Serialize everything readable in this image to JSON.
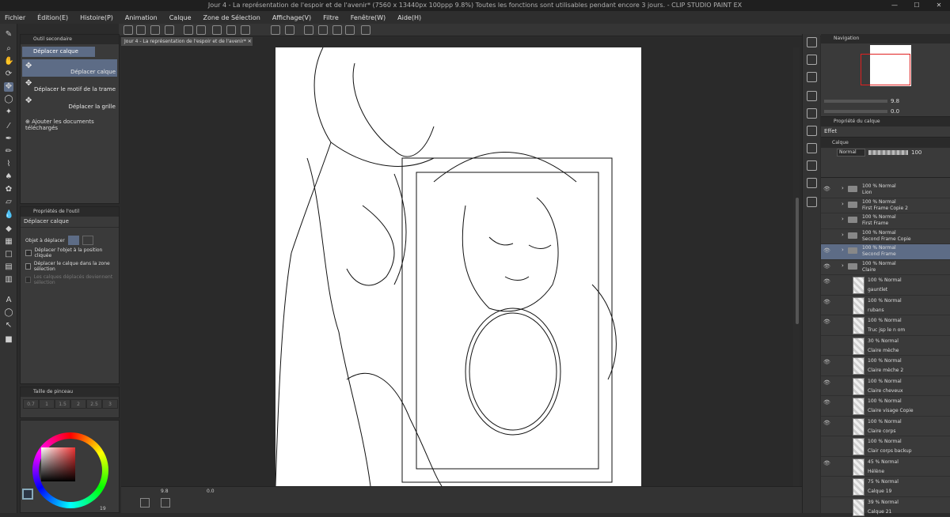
{
  "window": {
    "title": "Jour 4 - La représentation de l'espoir et de l'avenir* (7560 x 13440px 100ppp 9.8%)  Toutes les fonctions sont utilisables pendant encore 3 jours. - CLIP STUDIO PAINT EX"
  },
  "menu": [
    "Fichier",
    "Édition(E)",
    "Histoire(P)",
    "Animation",
    "Calque",
    "Zone de Sélection",
    "Affichage(V)",
    "Filtre",
    "Fenêtre(W)",
    "Aide(H)"
  ],
  "document": {
    "tab": "Jour 4 - La représentation de l'espoir et de l'avenir*"
  },
  "subtool": {
    "header": "Outil secondaire",
    "active_tab": "Déplacer calque",
    "items": [
      {
        "label": "Déplacer calque",
        "selected": true
      },
      {
        "label": "Déplacer le motif de la trame",
        "selected": false
      },
      {
        "label": "Déplacer la grille",
        "selected": false
      }
    ],
    "add_label": "Ajouter les documents téléchargés"
  },
  "toolprops": {
    "header": "Propriétés de l'outil",
    "title": "Déplacer calque",
    "target_label": "Objet à déplacer",
    "options": [
      "Déplacer l'objet à la position cliquée",
      "Déplacer le calque dans la zone sélection",
      "Les calques déplacés deviennent sélection"
    ]
  },
  "brushsize": {
    "header": "Taille de pinceau",
    "sizes": [
      "0.7",
      "1",
      "1.5",
      "2",
      "2.5",
      "3"
    ]
  },
  "color": {
    "counter": "19"
  },
  "canvas": {
    "zoom": "9.8",
    "angle": "0.0"
  },
  "navigator": {
    "header": "Navigation",
    "zoom": "9.8",
    "angle": "0.0"
  },
  "layerprop": {
    "header": "Propriété du calque",
    "effect_label": "Effet"
  },
  "layers": {
    "header": "Calque",
    "blend": "Normal",
    "opacity": "100",
    "rows": [
      {
        "mode": "100 % Normal",
        "name": "Lion",
        "type": "folder",
        "visible": true,
        "selected": false
      },
      {
        "mode": "100 % Normal",
        "name": "First Frame Copie 2",
        "type": "folder",
        "visible": false,
        "selected": false
      },
      {
        "mode": "100 % Normal",
        "name": "First Frame",
        "type": "folder",
        "visible": false,
        "selected": false
      },
      {
        "mode": "100 % Normal",
        "name": "Second Frame Copie",
        "type": "folder",
        "visible": false,
        "selected": false
      },
      {
        "mode": "100 % Normal",
        "name": "Second Frame",
        "type": "folder",
        "visible": true,
        "selected": true
      },
      {
        "mode": "100 % Normal",
        "name": "Claire",
        "type": "folder",
        "visible": true,
        "selected": false
      },
      {
        "mode": "100 % Normal",
        "name": "gauntlet",
        "type": "layer",
        "visible": true,
        "selected": false
      },
      {
        "mode": "100 % Normal",
        "name": "rubans",
        "type": "layer",
        "visible": true,
        "selected": false
      },
      {
        "mode": "100 % Normal",
        "name": "Truc jsp le n om",
        "type": "layer",
        "visible": true,
        "selected": false
      },
      {
        "mode": "30 % Normal",
        "name": "Claire mèche",
        "type": "layer",
        "visible": false,
        "selected": false
      },
      {
        "mode": "100 % Normal",
        "name": "Claire mèche 2",
        "type": "layer",
        "visible": true,
        "selected": false
      },
      {
        "mode": "100 % Normal",
        "name": "Claire cheveux",
        "type": "layer",
        "visible": true,
        "selected": false
      },
      {
        "mode": "100 % Normal",
        "name": "Claire visage Copie",
        "type": "layer",
        "visible": true,
        "selected": false
      },
      {
        "mode": "100 % Normal",
        "name": "Claire corps",
        "type": "layer",
        "visible": true,
        "selected": false
      },
      {
        "mode": "100 % Normal",
        "name": "Clair corps backup",
        "type": "layer",
        "visible": false,
        "selected": false
      },
      {
        "mode": "45 % Normal",
        "name": "Hélène",
        "type": "layer",
        "visible": true,
        "selected": false
      },
      {
        "mode": "75 % Normal",
        "name": "Calque 19",
        "type": "layer",
        "visible": false,
        "selected": false
      },
      {
        "mode": "39 % Normal",
        "name": "Calque 21",
        "type": "layer",
        "visible": false,
        "selected": false
      }
    ]
  }
}
